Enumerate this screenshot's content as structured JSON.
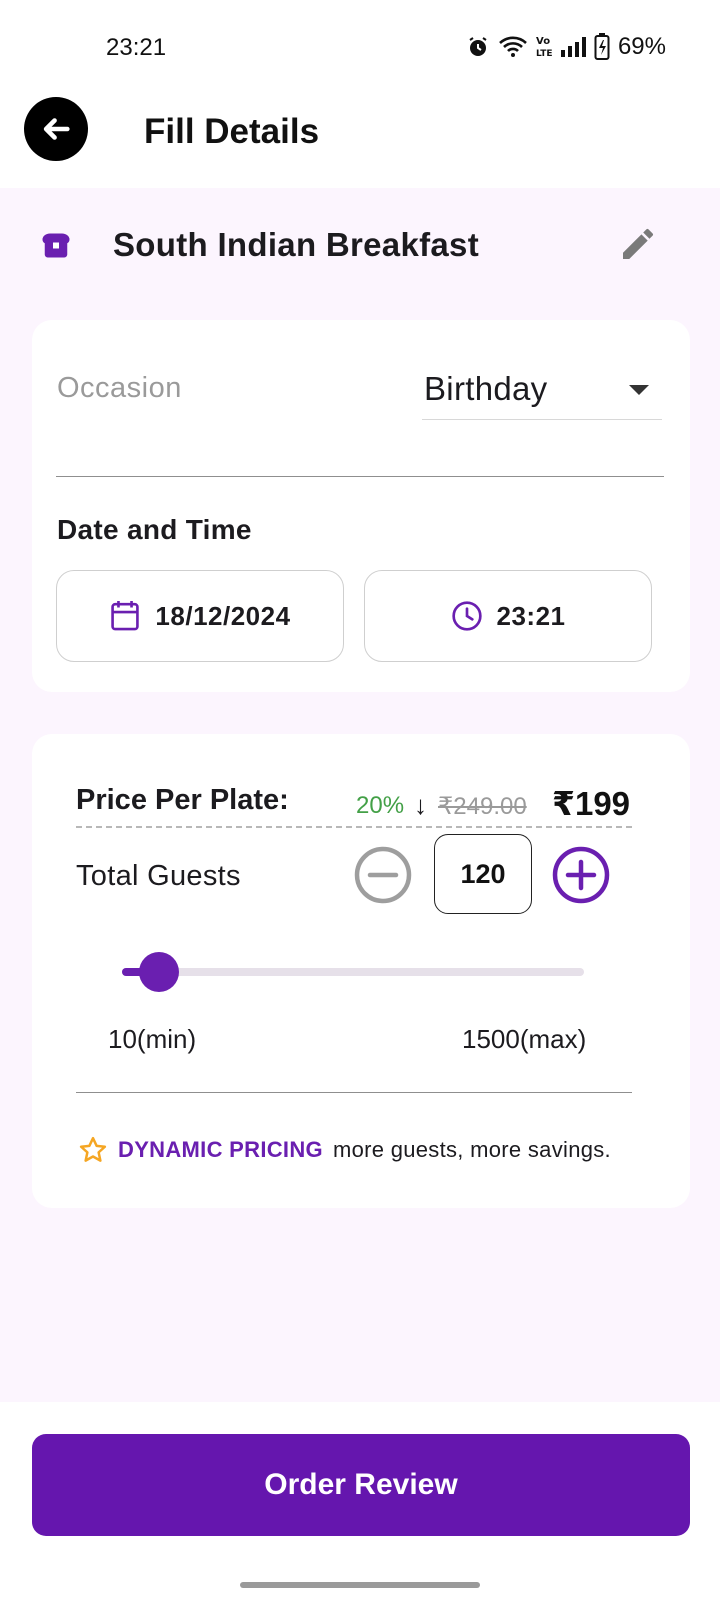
{
  "status_bar": {
    "time": "23:21",
    "battery": "69%",
    "icons": [
      "alarm-icon",
      "wifi-icon",
      "volte-icon",
      "signal-icon",
      "battery-icon"
    ]
  },
  "app_bar": {
    "title": "Fill Details",
    "back_icon": "arrow-left-icon"
  },
  "item": {
    "title": "South Indian Breakfast",
    "icon": "bread-icon",
    "edit_icon": "pencil-icon"
  },
  "occasion": {
    "label": "Occasion",
    "value": "Birthday"
  },
  "date_time": {
    "title": "Date and Time",
    "date": "18/12/2024",
    "time": "23:21"
  },
  "pricing": {
    "label": "Price Per Plate:",
    "discount": "20%",
    "arrow": "↓",
    "original_price": "₹249.00",
    "price": "₹199"
  },
  "guests": {
    "label": "Total Guests",
    "count": "120",
    "min_label": "10(min)",
    "max_label": "1500(max)",
    "slider_fraction": 0.08
  },
  "dynamic_pricing": {
    "strong": "DYNAMIC PRICING",
    "text": "more guests, more savings."
  },
  "footer": {
    "button": "Order Review"
  },
  "colors": {
    "accent": "#6a1fb0",
    "background": "#fcf5fe",
    "discount_green": "#43a047",
    "star": "#f5a623"
  }
}
